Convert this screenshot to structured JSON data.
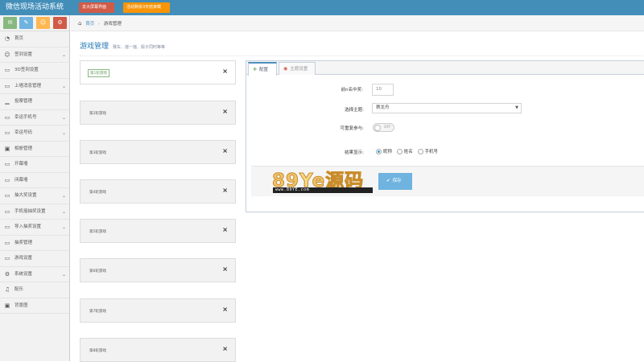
{
  "app": {
    "title": "微信现场活动系统",
    "fullscreen_label": "去大屏幕界面",
    "expiry_label": "活动剩余3天结束截"
  },
  "shortcuts": [
    {
      "icon": "chat-icon",
      "color": "#87b87f"
    },
    {
      "icon": "pencil-icon",
      "color": "#6fb3e0"
    },
    {
      "icon": "group-icon",
      "color": "#ffb752"
    },
    {
      "icon": "gear-icon",
      "color": "#d15b47"
    }
  ],
  "sidebar": {
    "items": [
      {
        "label": "首页",
        "icon": "dashboard-icon",
        "submenu": false
      },
      {
        "label": "签到设置",
        "icon": "users-icon",
        "submenu": true
      },
      {
        "label": "3D签到设置",
        "icon": "monitor-icon",
        "submenu": false
      },
      {
        "label": "上墙消息管理",
        "icon": "monitor-icon",
        "submenu": true
      },
      {
        "label": "投票管理",
        "icon": "bar-chart-icon",
        "submenu": false
      },
      {
        "label": "幸运手机号",
        "icon": "monitor-icon",
        "submenu": true
      },
      {
        "label": "幸运号码",
        "icon": "monitor-icon",
        "submenu": true
      },
      {
        "label": "相册管理",
        "icon": "picture-icon",
        "submenu": false
      },
      {
        "label": "开幕墙",
        "icon": "monitor-icon",
        "submenu": false
      },
      {
        "label": "闭幕墙",
        "icon": "monitor-icon",
        "submenu": false
      },
      {
        "label": "抽大奖设置",
        "icon": "monitor-icon",
        "submenu": true
      },
      {
        "label": "手机摇抽奖设置",
        "icon": "monitor-icon",
        "submenu": true
      },
      {
        "label": "导入抽奖设置",
        "icon": "monitor-icon",
        "submenu": true
      },
      {
        "label": "抽奖管理",
        "icon": "monitor-icon",
        "submenu": false
      },
      {
        "label": "游戏设置",
        "icon": "monitor-icon",
        "submenu": false
      },
      {
        "label": "系统设置",
        "icon": "gear-icon",
        "submenu": true
      },
      {
        "label": "配乐",
        "icon": "music-icon",
        "submenu": false
      },
      {
        "label": "背景图",
        "icon": "picture-icon",
        "submenu": false
      }
    ]
  },
  "breadcrumb": {
    "home": "首页",
    "current": "游戏管理"
  },
  "page": {
    "title": "游戏管理",
    "subtitle": "赛车、摇一摇、骰子同时等等"
  },
  "games": [
    {
      "label": "第1轮游戏",
      "active": true
    },
    {
      "label": "第2轮游戏",
      "active": false
    },
    {
      "label": "第3轮游戏",
      "active": false
    },
    {
      "label": "第4轮游戏",
      "active": false
    },
    {
      "label": "第5轮游戏",
      "active": false
    },
    {
      "label": "第6轮游戏",
      "active": false
    },
    {
      "label": "第7轮游戏",
      "active": false
    },
    {
      "label": "第8轮游戏",
      "active": false
    }
  ],
  "tabs": [
    {
      "label": "配置",
      "icon": "cog-icon"
    },
    {
      "label": "主题设置",
      "icon": "car-icon"
    }
  ],
  "form": {
    "top_n_label": "前n名中奖:",
    "top_n_value": "10",
    "theme_label": "选择主题:",
    "theme_value": "赛龙舟",
    "repeat_label": "可重复参与:",
    "repeat_toggle": "OFF",
    "display_label": "结果显示:",
    "display_options": [
      "昵称",
      "姓名",
      "手机号"
    ],
    "display_selected": "昵称",
    "save_label": "保存"
  },
  "watermark": {
    "brand_a": "89",
    "brand_y": "Y",
    "brand_e": "e",
    "brand_cn": "源码",
    "site": "www.89YE.com"
  },
  "colors": {
    "topbar": "#438eb9",
    "accent": "#6fb3e0",
    "danger": "#d15b47",
    "warning": "#f89406",
    "success": "#87b87f"
  }
}
